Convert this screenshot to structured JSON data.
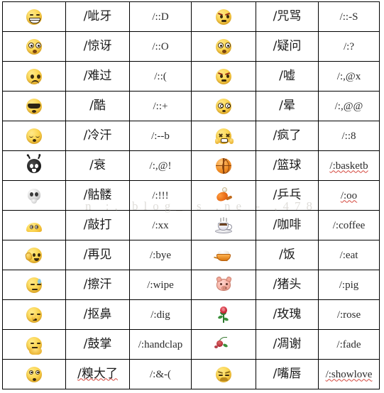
{
  "page": {
    "title": "QQ Emoticon Shortcut Code Table",
    "watermark": "n  :, blog_ s  .ne  - ,478"
  },
  "table": {
    "left_block": [
      {
        "icon": "grin-face-icon",
        "name": "/呲牙",
        "code": "/::D"
      },
      {
        "icon": "surprised-face-icon",
        "name": "/惊讶",
        "code": "/::O"
      },
      {
        "icon": "sad-face-icon",
        "name": "/难过",
        "code": "/::("
      },
      {
        "icon": "cool-sunglasses-icon",
        "name": "/酷",
        "code": "/::+"
      },
      {
        "icon": "cold-sweat-face-icon",
        "name": "/冷汗",
        "code": "/:--b"
      },
      {
        "icon": "devil-face-icon",
        "name": "/衰",
        "code": "/:,@!"
      },
      {
        "icon": "skull-icon",
        "name": "/骷髅",
        "code": "/:!!!"
      },
      {
        "icon": "knock-face-icon",
        "name": "/敲打",
        "code": "/:xx"
      },
      {
        "icon": "waving-face-icon",
        "name": "/再见",
        "code": "/:bye"
      },
      {
        "icon": "wipe-sweat-face-icon",
        "name": "/擦汗",
        "code": "/:wipe"
      },
      {
        "icon": "nose-dig-face-icon",
        "name": "/抠鼻",
        "code": "/:dig"
      },
      {
        "icon": "clapping-face-icon",
        "name": "/鼓掌",
        "code": "/:handclap"
      },
      {
        "icon": "embarrassed-face-icon",
        "name": "/糗大了",
        "code": "/:&-("
      }
    ],
    "right_block": [
      {
        "icon": "angry-face-icon",
        "name": "/咒骂",
        "code": "/::-S"
      },
      {
        "icon": "question-face-icon",
        "name": "/疑问",
        "code": "/:?"
      },
      {
        "icon": "shush-face-icon",
        "name": "/嘘",
        "code": "/:,@x"
      },
      {
        "icon": "dizzy-face-icon",
        "name": "/晕",
        "code": "/:,@@"
      },
      {
        "icon": "crazy-face-icon",
        "name": "/疯了",
        "code": "/::8"
      },
      {
        "icon": "basketball-icon",
        "name": "/篮球",
        "code": "/:basketb"
      },
      {
        "icon": "ping-pong-icon",
        "name": "/乒乓",
        "code": "/:oo"
      },
      {
        "icon": "coffee-cup-icon",
        "name": "/咖啡",
        "code": "/:coffee"
      },
      {
        "icon": "rice-bowl-icon",
        "name": "/饭",
        "code": "/:eat"
      },
      {
        "icon": "pig-head-icon",
        "name": "/猪头",
        "code": "/:pig"
      },
      {
        "icon": "rose-icon",
        "name": "/玫瑰",
        "code": "/:rose"
      },
      {
        "icon": "wilted-rose-icon",
        "name": "/凋谢",
        "code": "/:fade"
      },
      {
        "icon": "lips-face-icon",
        "name": "/嘴唇",
        "code": "/:showlove"
      }
    ],
    "spellcheck_codes": [
      "/:basketb",
      "/:oo",
      "/:showlove"
    ],
    "spellcheck_names": [
      "/糗大了"
    ]
  },
  "colors": {
    "border": "#000000",
    "background": "#ffffff",
    "text": "#1a1a1a",
    "code_text": "#2b2b2b",
    "spellcheck_underline": "#d4463c",
    "emoji_yellow": "#fcd856"
  }
}
